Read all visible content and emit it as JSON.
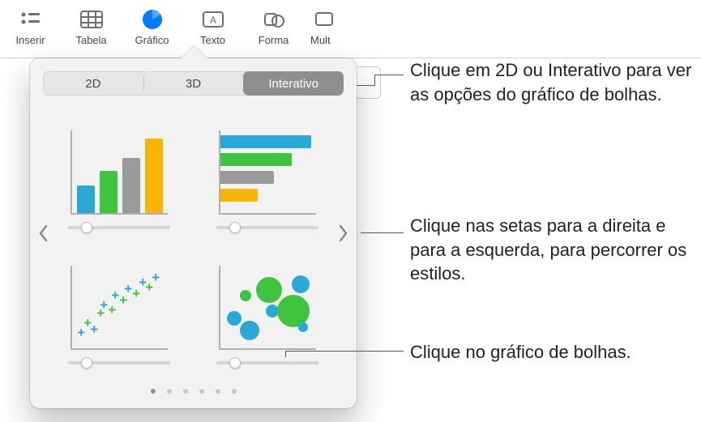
{
  "toolbar": {
    "items": [
      {
        "label": "Inserir",
        "icon": "insert-icon"
      },
      {
        "label": "Tabela",
        "icon": "table-icon"
      },
      {
        "label": "Gráfico",
        "icon": "chart-icon",
        "active": true
      },
      {
        "label": "Texto",
        "icon": "text-icon"
      },
      {
        "label": "Forma",
        "icon": "shape-icon"
      },
      {
        "label": "Mult",
        "icon": "media-icon"
      }
    ]
  },
  "segmented": {
    "items": [
      "2D",
      "3D",
      "Interativo"
    ],
    "selected": "Interativo"
  },
  "chart_thumbs": [
    {
      "name": "column-chart-thumb",
      "type": "column"
    },
    {
      "name": "bar-chart-thumb",
      "type": "bar"
    },
    {
      "name": "scatter-chart-thumb",
      "type": "scatter"
    },
    {
      "name": "bubble-chart-thumb",
      "type": "bubble"
    }
  ],
  "page_dots": {
    "count": 6,
    "active_index": 0
  },
  "annotations": {
    "a1": "Clique em 2D ou Interativo para ver as opções do gráfico de bolhas.",
    "a2": "Clique nas setas para a direita e para a esquerda, para percorrer os estilos.",
    "a3": "Clique no gráfico de bolhas."
  }
}
